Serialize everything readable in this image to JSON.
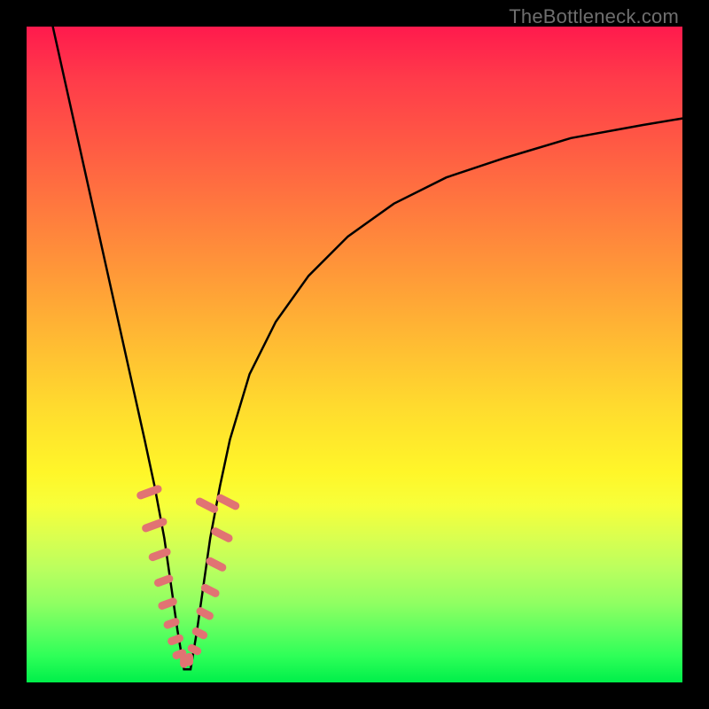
{
  "watermark": "TheBottleneck.com",
  "colors": {
    "marker": "#e17373",
    "curve": "#000000",
    "gradient_top": "#ff1a4d",
    "gradient_bottom": "#00ef4a",
    "frame": "#000000"
  },
  "chart_data": {
    "type": "line",
    "title": "",
    "xlabel": "",
    "ylabel": "",
    "xlim": [
      0,
      100
    ],
    "ylim": [
      0,
      100
    ],
    "note": "Axes are unlabeled in the source image; values are recovered from pixel geometry normalized to 0–100. y≈0 corresponds to the bottom (green) edge, y≈100 to the top (red) edge. Dip apex at roughly x≈24.",
    "series": [
      {
        "name": "bottleneck-curve",
        "x": [
          4,
          6,
          8,
          10,
          12,
          14,
          16,
          18,
          19.5,
          21,
          22,
          23,
          24,
          25,
          26,
          27,
          28,
          29.5,
          31,
          34,
          38,
          43,
          49,
          56,
          64,
          73,
          83,
          94,
          100
        ],
        "y": [
          100,
          91,
          82,
          73,
          64,
          55,
          46,
          37,
          30,
          22,
          15,
          8,
          2,
          2,
          8,
          15,
          22,
          30,
          37,
          47,
          55,
          62,
          68,
          73,
          77,
          80,
          83,
          85,
          86
        ]
      }
    ],
    "annotations": {
      "marker_cluster_description": "Salmon-colored capsule markers clustered along both sides of the V near the bottom, roughly in the x∈[18,30], y∈[3,30] region.",
      "marker_points": [
        {
          "x": 18.7,
          "y": 29.0,
          "len": 4.0,
          "tilt": "left"
        },
        {
          "x": 19.5,
          "y": 24.0,
          "len": 4.0,
          "tilt": "left"
        },
        {
          "x": 20.3,
          "y": 19.5,
          "len": 3.5,
          "tilt": "left"
        },
        {
          "x": 20.9,
          "y": 15.5,
          "len": 3.0,
          "tilt": "left"
        },
        {
          "x": 21.5,
          "y": 12.0,
          "len": 3.0,
          "tilt": "left"
        },
        {
          "x": 22.1,
          "y": 9.0,
          "len": 2.5,
          "tilt": "left"
        },
        {
          "x": 22.7,
          "y": 6.5,
          "len": 2.5,
          "tilt": "left"
        },
        {
          "x": 23.3,
          "y": 4.3,
          "len": 2.2,
          "tilt": "left"
        },
        {
          "x": 24.0,
          "y": 3.2,
          "len": 2.0,
          "tilt": "flat"
        },
        {
          "x": 24.8,
          "y": 3.5,
          "len": 2.0,
          "tilt": "flat"
        },
        {
          "x": 25.6,
          "y": 5.0,
          "len": 2.2,
          "tilt": "right"
        },
        {
          "x": 26.4,
          "y": 7.5,
          "len": 2.5,
          "tilt": "right"
        },
        {
          "x": 27.2,
          "y": 10.5,
          "len": 2.8,
          "tilt": "right"
        },
        {
          "x": 27.5,
          "y": 27.0,
          "len": 3.7,
          "tilt": "right"
        },
        {
          "x": 28.0,
          "y": 14.0,
          "len": 3.0,
          "tilt": "right"
        },
        {
          "x": 28.9,
          "y": 18.0,
          "len": 3.3,
          "tilt": "right"
        },
        {
          "x": 29.8,
          "y": 22.5,
          "len": 3.5,
          "tilt": "right"
        },
        {
          "x": 30.7,
          "y": 27.5,
          "len": 3.8,
          "tilt": "right"
        }
      ]
    }
  }
}
